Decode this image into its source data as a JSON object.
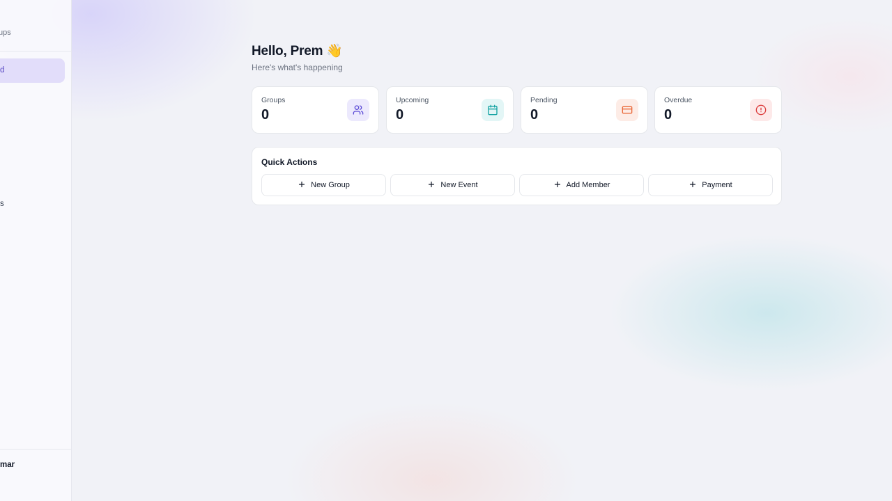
{
  "sidebar": {
    "brand_subtitle": "ups",
    "active_item_label": "d",
    "item_label": "s",
    "user_name": "mar"
  },
  "greeting": {
    "title": "Hello, Prem 👋",
    "subtitle": "Here's what's happening"
  },
  "stats": [
    {
      "label": "Groups",
      "value": "0",
      "icon": "users-icon",
      "color": "#5b4bd6",
      "bg": "#ece9fd"
    },
    {
      "label": "Upcoming",
      "value": "0",
      "icon": "calendar-icon",
      "color": "#14a3a3",
      "bg": "#e3f6f6"
    },
    {
      "label": "Pending",
      "value": "0",
      "icon": "credit-card-icon",
      "color": "#ea6a3a",
      "bg": "#fdece6"
    },
    {
      "label": "Overdue",
      "value": "0",
      "icon": "alert-circle-icon",
      "color": "#dc3b3b",
      "bg": "#fde9e9"
    }
  ],
  "quick_actions": {
    "title": "Quick Actions",
    "buttons": [
      {
        "label": "New Group",
        "icon": "plus-icon"
      },
      {
        "label": "New Event",
        "icon": "plus-icon"
      },
      {
        "label": "Add Member",
        "icon": "plus-icon"
      },
      {
        "label": "Payment",
        "icon": "plus-icon"
      }
    ]
  }
}
